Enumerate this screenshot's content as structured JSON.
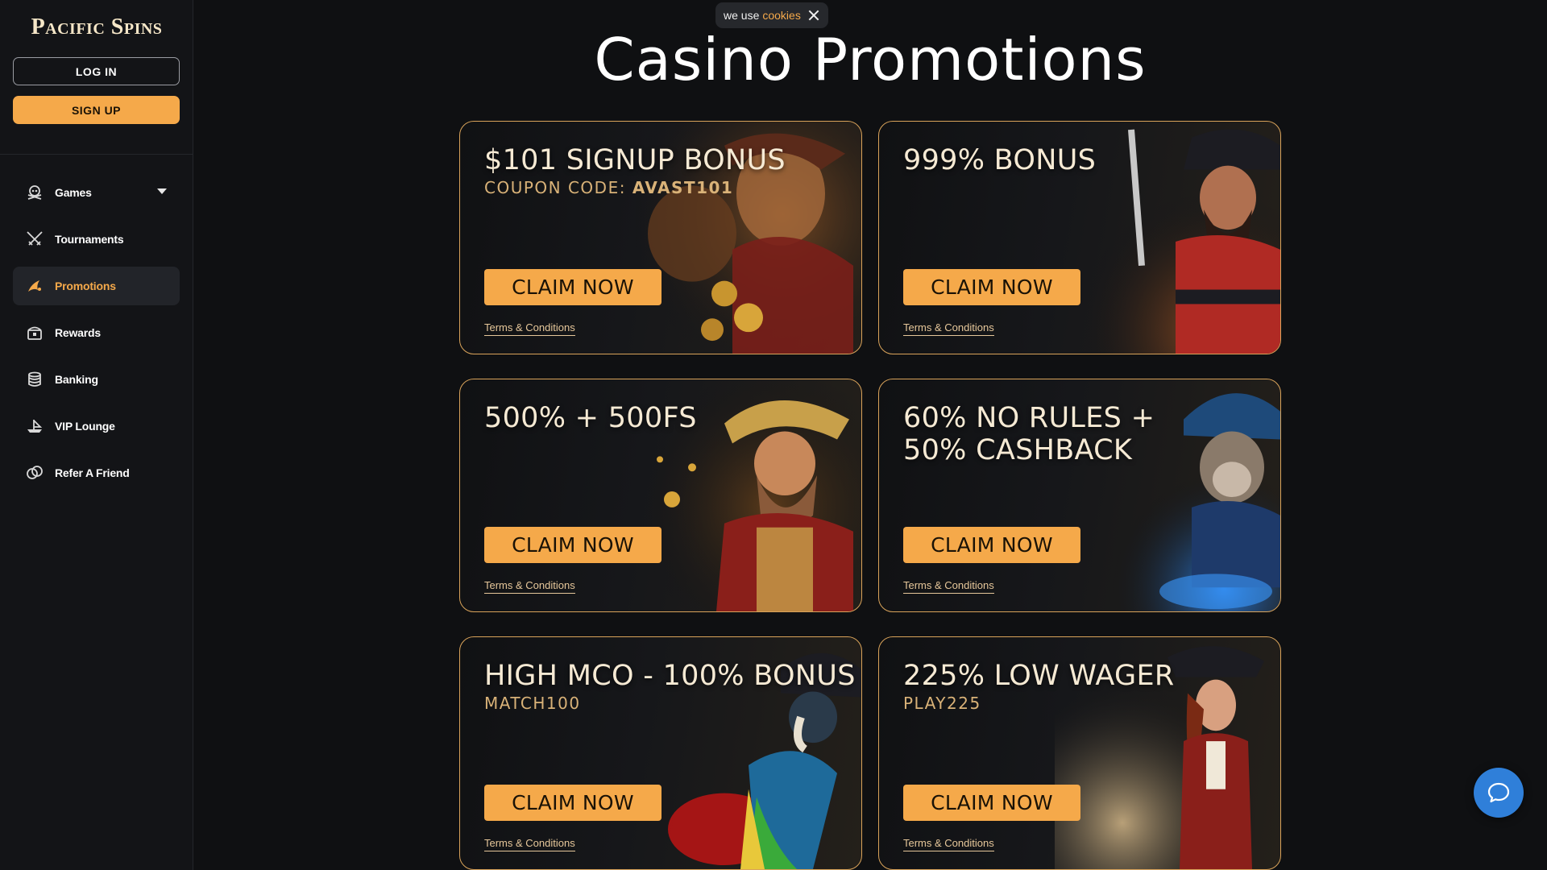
{
  "sidebar": {
    "logo": "Pacific Spins",
    "login_label": "LOG IN",
    "signup_label": "SIGN UP",
    "nav": [
      {
        "label": "Games",
        "icon": "pirate-skull-icon"
      },
      {
        "label": "Tournaments",
        "icon": "crossed-swords-icon"
      },
      {
        "label": "Promotions",
        "icon": "promotions-icon",
        "active": true
      },
      {
        "label": "Rewards",
        "icon": "treasure-chest-icon"
      },
      {
        "label": "Banking",
        "icon": "coins-stack-icon"
      },
      {
        "label": "VIP Lounge",
        "icon": "ship-icon"
      },
      {
        "label": "Refer A Friend",
        "icon": "handshake-icon"
      }
    ]
  },
  "cookie": {
    "text": "we use",
    "link": "cookies"
  },
  "page_title": "Casino Promotions",
  "promos": [
    {
      "title": "$101 SIGNUP BONUS",
      "sub_prefix": "COUPON CODE: ",
      "sub_code": "AVAST101",
      "cta": "CLAIM NOW",
      "terms": "Terms & Conditions"
    },
    {
      "title": "999% BONUS",
      "sub_prefix": "",
      "sub_code": "",
      "cta": "CLAIM NOW",
      "terms": "Terms & Conditions"
    },
    {
      "title": "500% + 500FS",
      "sub_prefix": "",
      "sub_code": "",
      "cta": "CLAIM NOW",
      "terms": "Terms & Conditions"
    },
    {
      "title": "60% NO RULES + 50% CASHBACK",
      "sub_prefix": "",
      "sub_code": "",
      "cta": "CLAIM NOW",
      "terms": "Terms & Conditions"
    },
    {
      "title": "HIGH MCO - 100% BONUS",
      "sub_prefix": "MATCH100",
      "sub_code": "",
      "cta": "CLAIM NOW",
      "terms": "Terms & Conditions"
    },
    {
      "title": "225% LOW WAGER",
      "sub_prefix": "PLAY225",
      "sub_code": "",
      "cta": "CLAIM NOW",
      "terms": "Terms & Conditions"
    }
  ],
  "colors": {
    "accent": "#f5a94a",
    "background": "#0f1012",
    "card_border": "#d9a35a",
    "chat": "#2f7fd9"
  }
}
